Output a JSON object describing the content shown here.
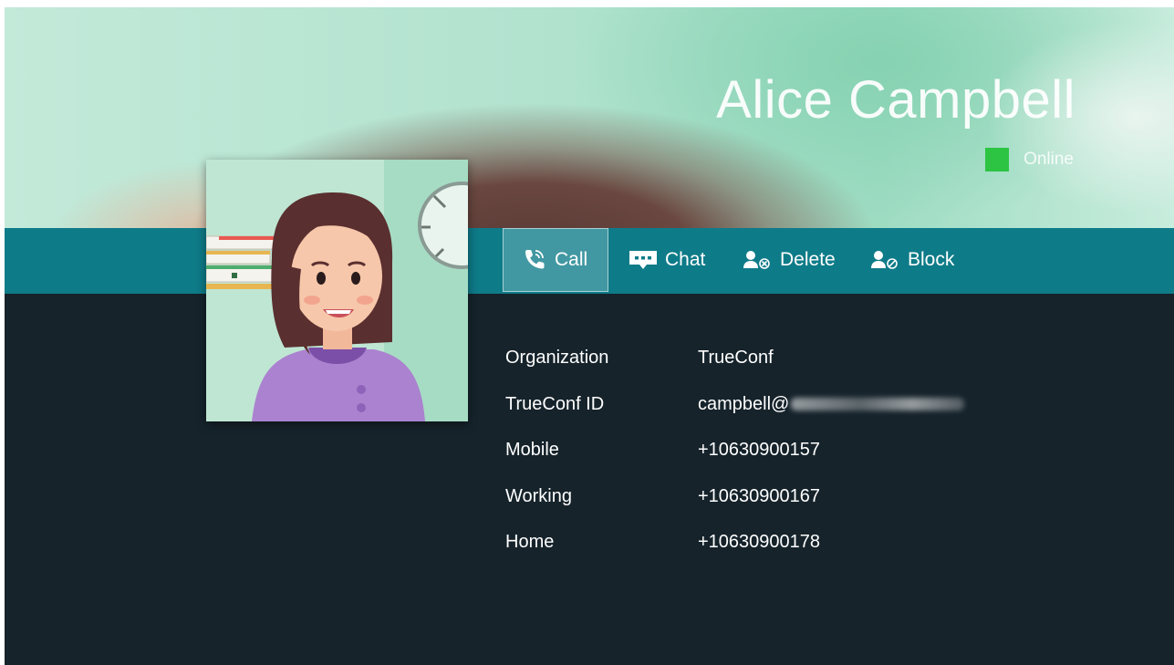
{
  "contact": {
    "name": "Alice Campbell",
    "status": "Online",
    "status_color": "#2dc443"
  },
  "toolbar": {
    "call_label": "Call",
    "chat_label": "Chat",
    "delete_label": "Delete",
    "block_label": "Block",
    "bar_color": "#0e7b88"
  },
  "details": {
    "organization": {
      "label": "Organization",
      "value": "TrueConf"
    },
    "trueconf_id": {
      "label": "TrueConf ID",
      "value": "campbell@"
    },
    "mobile": {
      "label": "Mobile",
      "value": "+10630900157"
    },
    "working": {
      "label": "Working",
      "value": "+10630900167"
    },
    "home": {
      "label": "Home",
      "value": "+10630900178"
    }
  },
  "icons": {
    "call": "phone-icon",
    "chat": "chat-bubble-icon",
    "delete": "user-delete-icon",
    "block": "user-block-icon"
  }
}
